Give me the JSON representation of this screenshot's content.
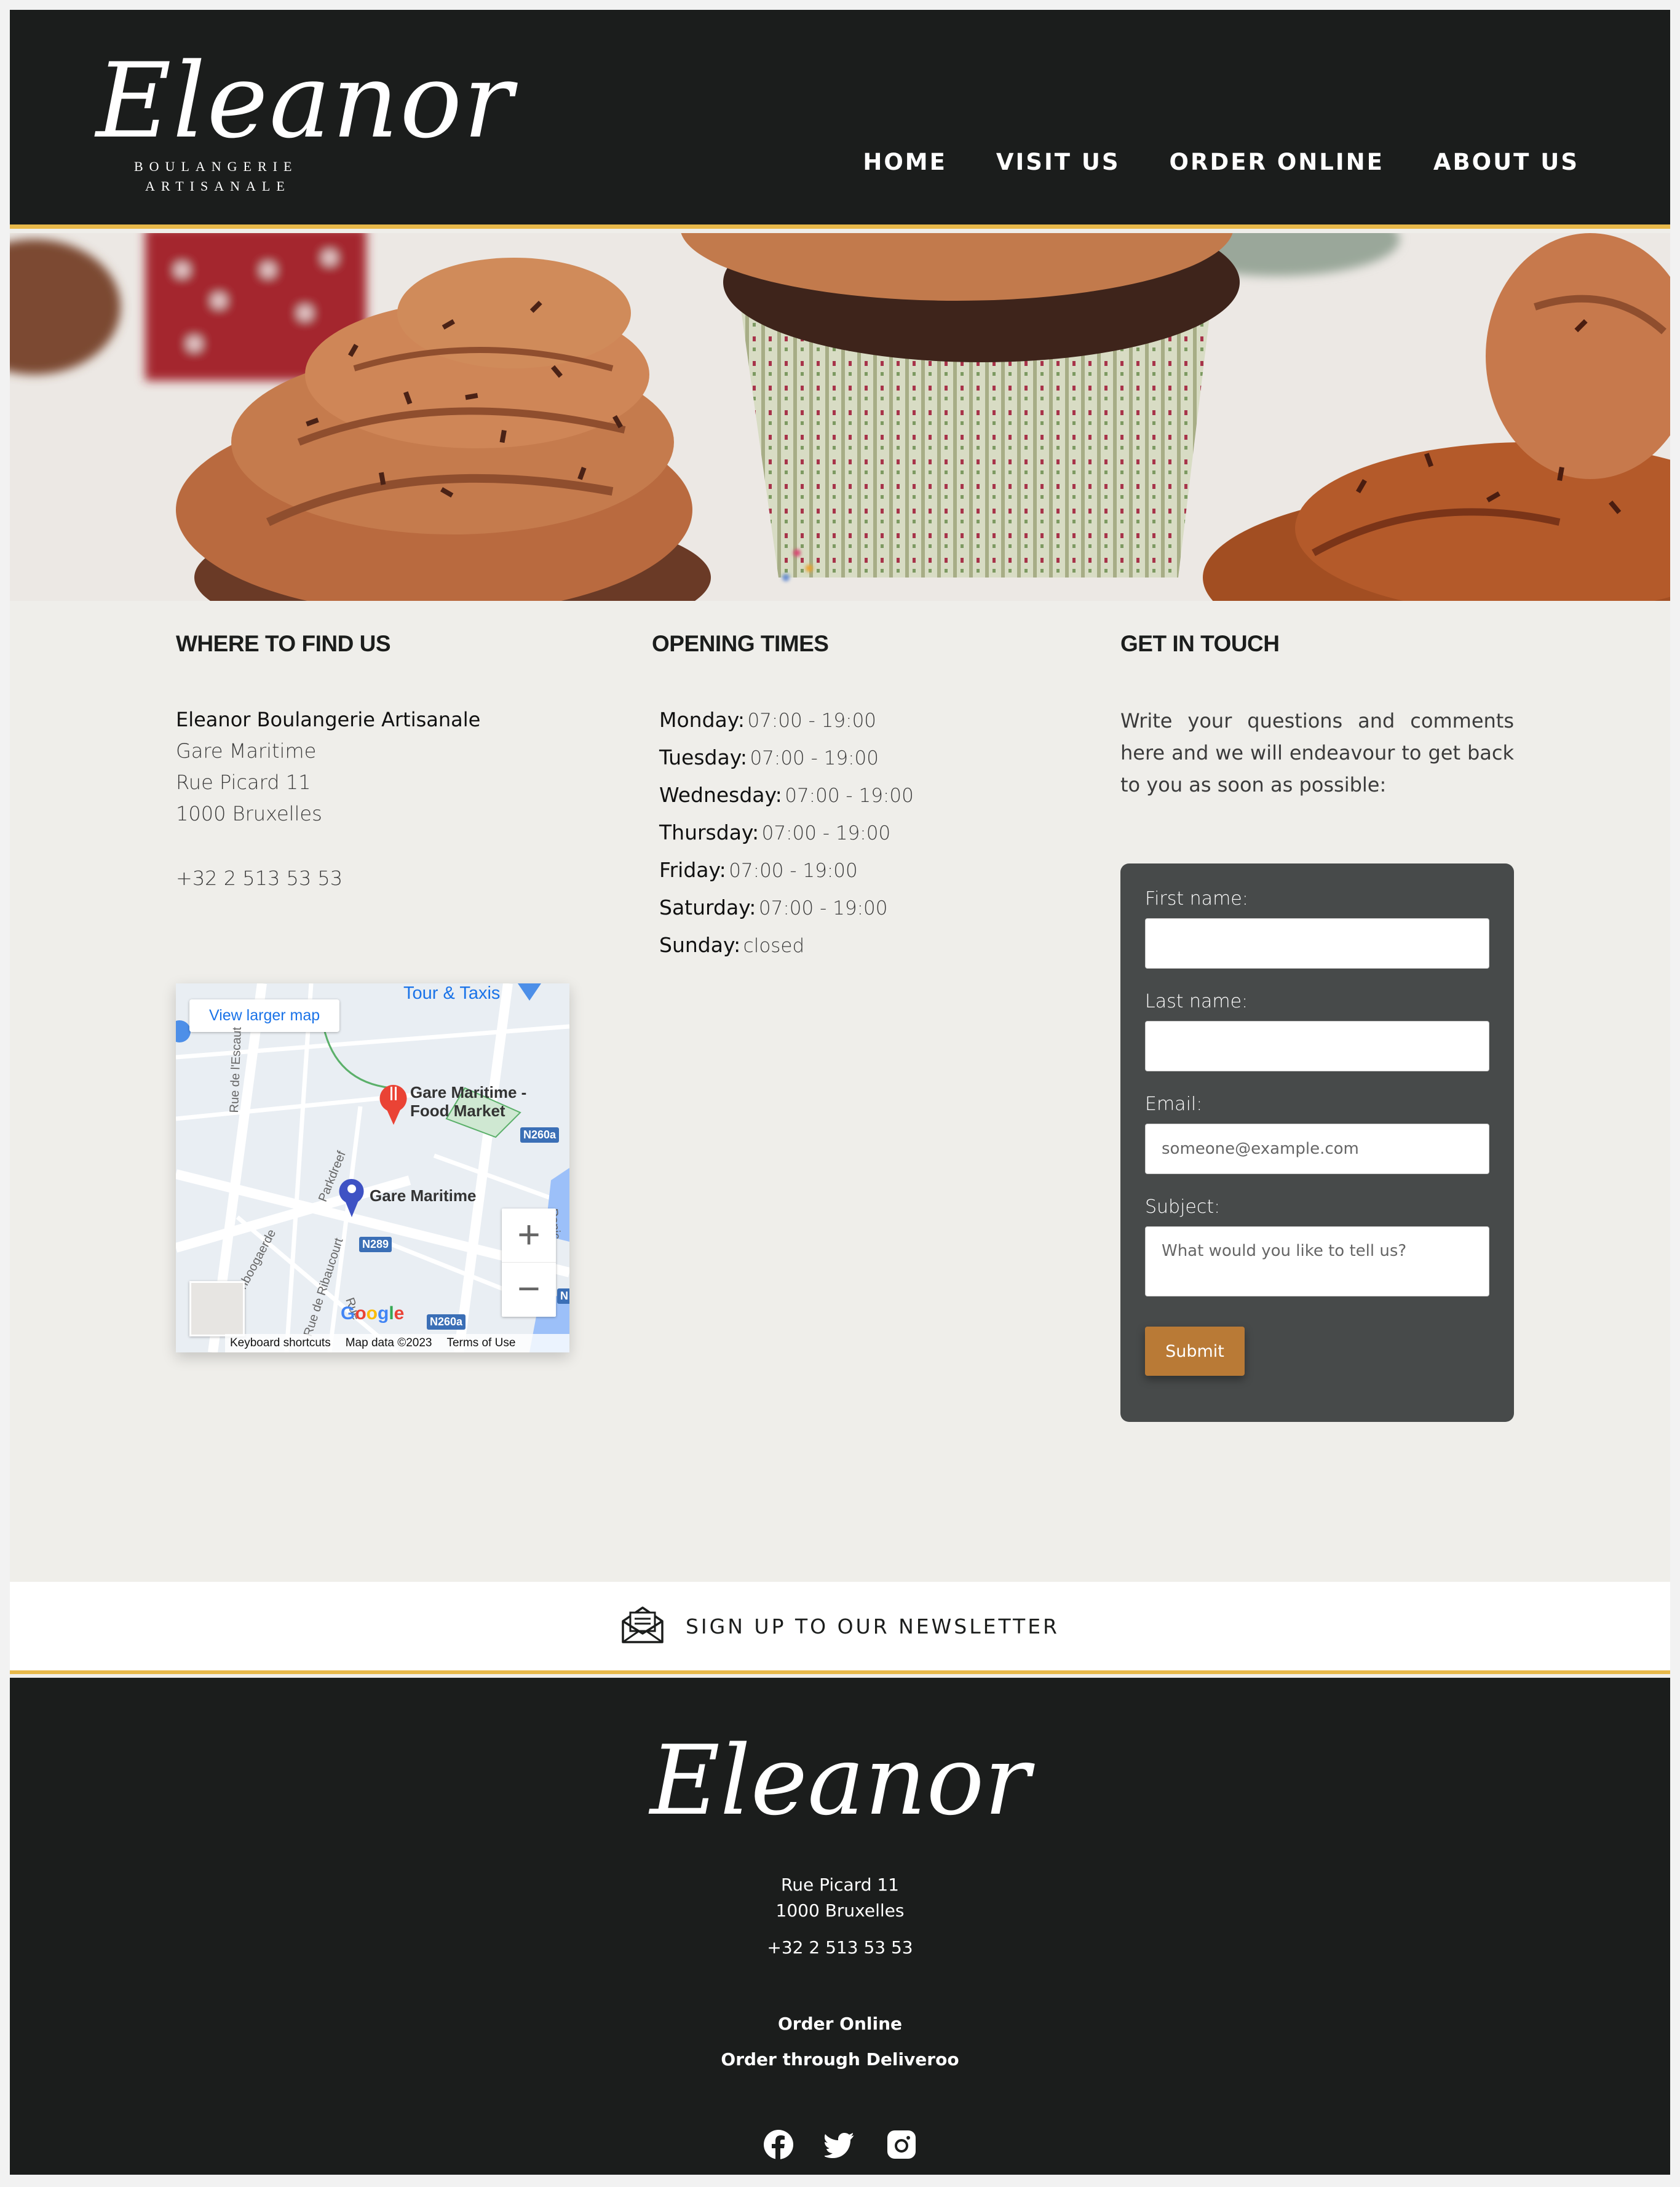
{
  "brand": {
    "logo_script": "Eleanor",
    "logo_line1": "BOULANGERIE",
    "logo_line2": "ARTISANALE"
  },
  "nav": {
    "items": [
      {
        "label": "HOME"
      },
      {
        "label": "VISIT US"
      },
      {
        "label": "ORDER ONLINE"
      },
      {
        "label": "ABOUT US"
      }
    ]
  },
  "hero": {
    "icon": "cupcakes-photo"
  },
  "where": {
    "title": "WHERE TO FIND US",
    "name": "Eleanor Boulangerie Artisanale",
    "lines": [
      "Gare Maritime",
      "Rue Picard 11",
      "1000 Bruxelles"
    ],
    "phone": "+32 2 513 53 53"
  },
  "map": {
    "view_larger": "View larger map",
    "tour_label": "Tour & Taxis",
    "place1": "Gare Maritime -",
    "place1b": "Food Market",
    "place2": "Gare Maritime",
    "streets": [
      "Rue de l'Escaut",
      "Parkdreef",
      "odenboogaerde",
      "Rue de Ribaucourt",
      "Rue",
      "Penic"
    ],
    "badges": [
      "N260a",
      "N289",
      "N260a",
      "N"
    ],
    "zoom_in": "+",
    "zoom_out": "−",
    "google": "Google",
    "footer": [
      "Keyboard shortcuts",
      "Map data ©2023",
      "Terms of Use"
    ]
  },
  "hours": {
    "title": "OPENING TIMES",
    "rows": [
      {
        "day": "Monday:",
        "time": "07:00 - 19:00"
      },
      {
        "day": "Tuesday:",
        "time": "07:00 - 19:00"
      },
      {
        "day": "Wednesday:",
        "time": "07:00 - 19:00"
      },
      {
        "day": "Thursday:",
        "time": "07:00 - 19:00"
      },
      {
        "day": "Friday:",
        "time": "07:00 - 19:00"
      },
      {
        "day": "Saturday:",
        "time": "07:00 - 19:00"
      },
      {
        "day": "Sunday:",
        "time": "closed"
      }
    ]
  },
  "touch": {
    "title": "GET IN TOUCH",
    "text": "Write your questions and comments here and we will endeavour to get back to you as soon as possible:",
    "first_label": "First name:",
    "last_label": "Last name:",
    "email_label": "Email:",
    "email_placeholder": "someone@example.com",
    "subject_label": "Subject:",
    "subject_placeholder": "What would you like to tell us?",
    "submit": "Submit"
  },
  "newsletter": {
    "label": "SIGN UP TO OUR NEWSLETTER",
    "icon": "envelope-icon"
  },
  "footer": {
    "logo": "Eleanor",
    "street": "Rue Picard 11",
    "city": "1000 Bruxelles",
    "phone": "+32 2 513 53 53",
    "order": "Order Online",
    "deliveroo": "Order through Deliveroo",
    "social": [
      "facebook-icon",
      "twitter-icon",
      "instagram-icon"
    ]
  },
  "colors": {
    "dark": "#1b1d1c",
    "accent_gold": "#e8b94a",
    "page_bg": "#efeeea",
    "form_bg": "#474a4a",
    "submit": "#b97a36",
    "map_link": "#1a73e8"
  }
}
